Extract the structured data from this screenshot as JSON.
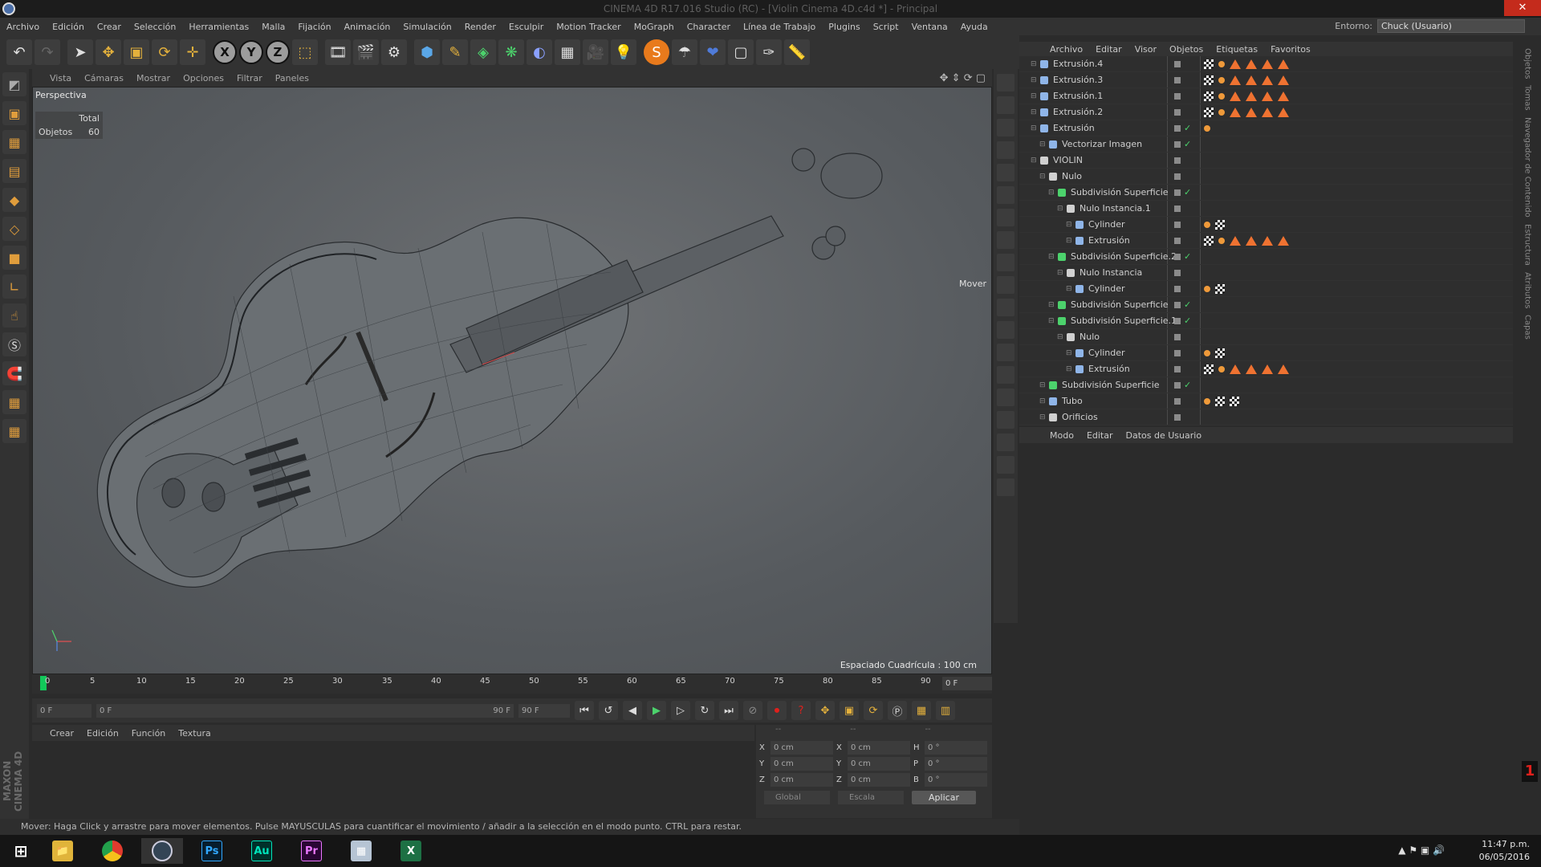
{
  "window": {
    "title": "CINEMA 4D R17.016 Studio (RC) - [Violin Cinema 4D.c4d *] - Principal",
    "close_label": "✕"
  },
  "menubar": {
    "items": [
      "Archivo",
      "Edición",
      "Crear",
      "Selección",
      "Herramientas",
      "Malla",
      "Fijación",
      "Animación",
      "Simulación",
      "Render",
      "Esculpir",
      "Motion Tracker",
      "MoGraph",
      "Character",
      "Línea de Trabajo",
      "Plugins",
      "Script",
      "Ventana",
      "Ayuda"
    ],
    "env_label": "Entorno:",
    "env_value": "Chuck (Usuario)"
  },
  "toolbar": {
    "icons": [
      "undo-icon",
      "redo-icon",
      "select-arrow-icon",
      "move-icon",
      "scale-icon",
      "rotate-icon",
      "live-select-icon",
      "axis-x",
      "axis-y",
      "axis-z",
      "world-coords-icon",
      "render-view-icon",
      "render-picture-queue-icon",
      "render-settings-icon",
      "cube-icon",
      "pen-spline-icon",
      "subdivision-icon",
      "mograph-cloner-icon",
      "deformer-icon",
      "floor-scene-icon",
      "camera-icon",
      "light-icon",
      "s-plugin-icon",
      "material-icon",
      "target-icon",
      "texture-icon",
      "sketch-icon",
      "ruler-icon"
    ],
    "axis_x": "X",
    "axis_y": "Y",
    "axis_z": "Z"
  },
  "viewport": {
    "menu": [
      "Vista",
      "Cámaras",
      "Mostrar",
      "Opciones",
      "Filtrar",
      "Paneles"
    ],
    "label": "Perspectiva",
    "stats_total": "Total",
    "stats_objects_label": "Objetos",
    "stats_objects_value": "60",
    "grid_spacing": "Espaciado Cuadrícula : 100 cm",
    "move_label": "Mover"
  },
  "timeline": {
    "ticks": [
      "0",
      "5",
      "10",
      "15",
      "20",
      "25",
      "30",
      "35",
      "40",
      "45",
      "50",
      "55",
      "60",
      "65",
      "70",
      "75",
      "80",
      "85",
      "90"
    ],
    "current_frame": "0 F",
    "start_field": "0 F",
    "range_start": "0 F",
    "range_end": "90 F",
    "end_field": "90 F"
  },
  "materials": {
    "menu": [
      "Crear",
      "Edición",
      "Función",
      "Textura"
    ]
  },
  "maxon_logo": "MAXON CINEMA 4D",
  "coords": {
    "headers": [
      "--",
      "--",
      "--"
    ],
    "rows": [
      {
        "l1": "X",
        "v1": "0 cm",
        "l2": "X",
        "v2": "0 cm",
        "l3": "H",
        "v3": "0 °"
      },
      {
        "l1": "Y",
        "v1": "0 cm",
        "l2": "Y",
        "v2": "0 cm",
        "l3": "P",
        "v3": "0 °"
      },
      {
        "l1": "Z",
        "v1": "0 cm",
        "l2": "Z",
        "v2": "0 cm",
        "l3": "B",
        "v3": "0 °"
      }
    ],
    "mode1": "Global",
    "mode2": "Escala",
    "apply": "Aplicar"
  },
  "status": "Mover: Haga Click y arrastre para mover elementos. Pulse MAYUSCULAS para cuantificar el movimiento / añadir a la selección en el modo punto. CTRL para restar.",
  "objects": {
    "menu": [
      "Archivo",
      "Editar",
      "Visor",
      "Objetos",
      "Etiquetas",
      "Favoritos"
    ],
    "rows": [
      {
        "name": "Extrusión.4",
        "indent": 0,
        "tags": "chk-dot-tri4",
        "check": false
      },
      {
        "name": "Extrusión.3",
        "indent": 0,
        "tags": "chk-dot-tri4",
        "check": false
      },
      {
        "name": "Extrusión.1",
        "indent": 0,
        "tags": "chk-dot-tri4",
        "check": false
      },
      {
        "name": "Extrusión.2",
        "indent": 0,
        "tags": "chk-dot-tri4",
        "check": false
      },
      {
        "name": "Extrusión",
        "indent": 0,
        "tags": "dot",
        "check": true
      },
      {
        "name": "Vectorizar Imagen",
        "indent": 1,
        "tags": "",
        "check": true
      },
      {
        "name": "VIOLIN",
        "indent": 0,
        "tags": "",
        "check": false
      },
      {
        "name": "Nulo",
        "indent": 1,
        "tags": "",
        "check": false
      },
      {
        "name": "Subdivisión Superficie",
        "indent": 2,
        "tags": "",
        "check": true
      },
      {
        "name": "Nulo Instancia.1",
        "indent": 3,
        "tags": "",
        "check": false
      },
      {
        "name": "Cylinder",
        "indent": 4,
        "tags": "dot-chk",
        "check": false
      },
      {
        "name": "Extrusión",
        "indent": 4,
        "tags": "chk-dot-tri4",
        "check": false
      },
      {
        "name": "Subdivisión Superficie.2",
        "indent": 2,
        "tags": "",
        "check": true
      },
      {
        "name": "Nulo Instancia",
        "indent": 3,
        "tags": "",
        "check": false
      },
      {
        "name": "Cylinder",
        "indent": 4,
        "tags": "dot-chk",
        "check": false
      },
      {
        "name": "Subdivisión Superficie",
        "indent": 2,
        "tags": "",
        "check": true
      },
      {
        "name": "Subdivisión Superficie.1",
        "indent": 2,
        "tags": "",
        "check": true
      },
      {
        "name": "Nulo",
        "indent": 3,
        "tags": "",
        "check": false
      },
      {
        "name": "Cylinder",
        "indent": 4,
        "tags": "dot-chk",
        "check": false
      },
      {
        "name": "Extrusión",
        "indent": 4,
        "tags": "chk-dot-tri4",
        "check": false
      },
      {
        "name": "Subdivisión Superficie",
        "indent": 1,
        "tags": "",
        "check": true
      },
      {
        "name": "Tubo",
        "indent": 1,
        "tags": "dot-chk-chk",
        "check": false
      },
      {
        "name": "Orificios",
        "indent": 1,
        "tags": "",
        "check": false
      }
    ]
  },
  "attributes": {
    "menu": [
      "Modo",
      "Editar",
      "Datos de Usuario"
    ]
  },
  "side_tabs": [
    "Objetos",
    "Tomas",
    "Navegador de Contenido",
    "Estructura",
    "Atributos",
    "Capas"
  ],
  "red_badge": "1",
  "taskbar": {
    "apps": [
      "windows-start-icon",
      "file-explorer-icon",
      "chrome-icon",
      "cinema4d-icon",
      "photoshop-icon",
      "audition-icon",
      "premiere-icon",
      "calculator-icon",
      "excel-icon"
    ],
    "ps": "Ps",
    "au": "Au",
    "pr": "Pr",
    "xl": "X",
    "time": "11:47 p.m.",
    "date": "06/05/2016"
  },
  "colors": {
    "accent_orange": "#ef7231",
    "check_green": "#4cd26c",
    "playhead_green": "#12c85a"
  }
}
